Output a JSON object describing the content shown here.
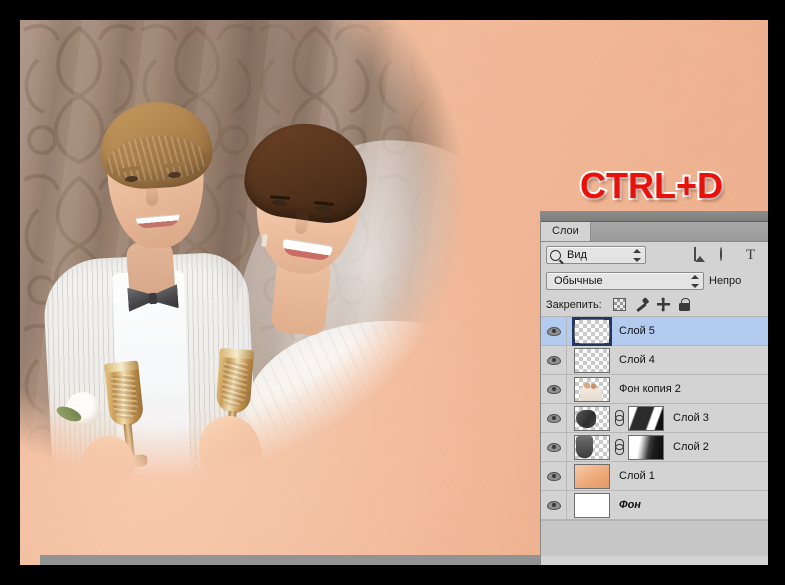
{
  "overlay": {
    "hotkey_text": "CTRL+D",
    "hotkey_color": "#e8120b",
    "hotkey_outline": "#ffffff"
  },
  "canvas": {
    "background_color": "#efb593",
    "strip_color": "#939393",
    "border_color": "#000000",
    "photo_description": "wedding couple photo masked into a circle"
  },
  "panel": {
    "tabs": [
      {
        "label": "Слои",
        "active": true
      }
    ],
    "filter": {
      "icon": "search-icon",
      "value": "Вид",
      "stepper": "chevron-updown-icon",
      "quick_filters": [
        {
          "name": "image-filter-icon",
          "glyph": ""
        },
        {
          "name": "adjustment-filter-icon",
          "glyph": ""
        },
        {
          "name": "type-filter-icon",
          "glyph": "T"
        }
      ]
    },
    "blend": {
      "value": "Обычные",
      "stepper": "chevron-updown-icon",
      "opacity_label": "Непро"
    },
    "lock": {
      "title": "Закрепить:",
      "toggles": [
        {
          "name": "lock-transparency-icon"
        },
        {
          "name": "lock-image-pixels-icon"
        },
        {
          "name": "lock-position-icon"
        },
        {
          "name": "lock-all-icon"
        }
      ]
    },
    "layers": [
      {
        "name": "Слой 5",
        "visible": true,
        "selected": true,
        "thumb": "checker",
        "thumb_selected": true,
        "mask": null,
        "italic": false
      },
      {
        "name": "Слой 4",
        "visible": true,
        "selected": false,
        "thumb": "checker",
        "thumb_selected": false,
        "mask": null,
        "italic": false
      },
      {
        "name": "Фон копия 2",
        "visible": true,
        "selected": false,
        "thumb": "couple",
        "thumb_selected": false,
        "mask": null,
        "italic": false
      },
      {
        "name": "Слой 3",
        "visible": true,
        "selected": false,
        "thumb": "paint-a",
        "thumb_selected": false,
        "mask": "mask-a",
        "italic": false
      },
      {
        "name": "Слой 2",
        "visible": true,
        "selected": false,
        "thumb": "paint-b",
        "thumb_selected": false,
        "mask": "mask-b",
        "italic": false
      },
      {
        "name": "Слой 1",
        "visible": true,
        "selected": false,
        "thumb": "peach",
        "thumb_selected": false,
        "mask": null,
        "italic": false
      },
      {
        "name": "Фон",
        "visible": true,
        "selected": false,
        "thumb": "white",
        "thumb_selected": false,
        "mask": null,
        "italic": true
      }
    ]
  }
}
